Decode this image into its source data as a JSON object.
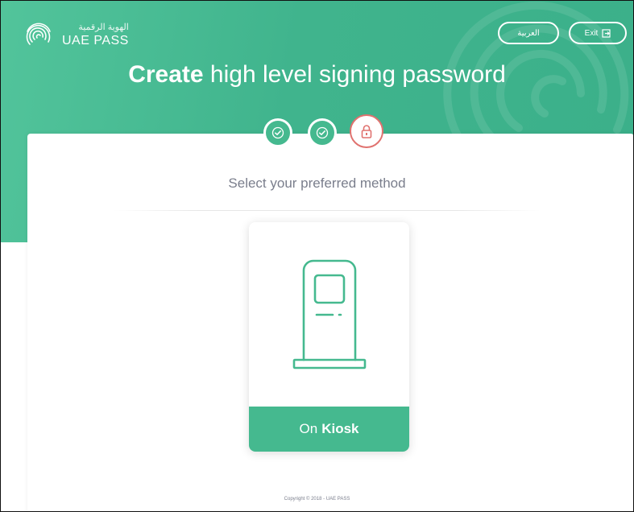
{
  "brand": {
    "arabic_name": "الهوية الرقمية",
    "name": "UAE PASS",
    "logo_icon": "fingerprint-icon"
  },
  "header": {
    "language_button": "العربية",
    "exit_button": "Exit",
    "exit_icon": "exit-icon"
  },
  "page": {
    "title_bold": "Create",
    "title_rest": "high level signing password",
    "subtitle": "Select your preferred method"
  },
  "steps": [
    {
      "status": "completed",
      "icon": "check-icon"
    },
    {
      "status": "completed",
      "icon": "check-icon"
    },
    {
      "status": "current",
      "icon": "lock-icon"
    }
  ],
  "methods": [
    {
      "icon": "kiosk-icon",
      "label_prefix": "On",
      "label_bold": "Kiosk"
    }
  ],
  "footer": {
    "copyright": "Copyright © 2018 - UAE PASS"
  },
  "colors": {
    "primary_green": "#45b98f",
    "header_green": "#40b48d",
    "lock_accent": "#e0726f",
    "muted_text": "#7a7e8c"
  }
}
